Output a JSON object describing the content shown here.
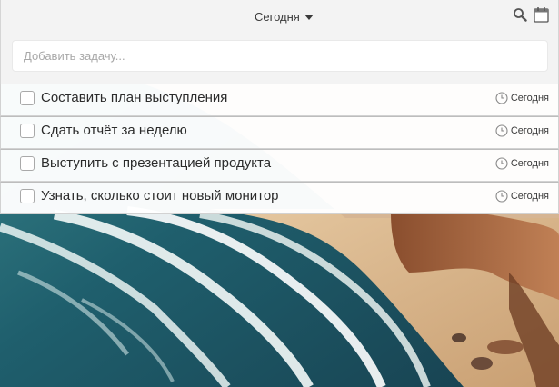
{
  "header": {
    "title": "Сегодня",
    "search_icon": "search-icon",
    "calendar_icon": "calendar-icon"
  },
  "add_task": {
    "placeholder": "Добавить задачу..."
  },
  "tasks": [
    {
      "text": "Составить план выступления",
      "due": "Сегодня",
      "done": false
    },
    {
      "text": "Сдать отчёт за неделю",
      "due": "Сегодня",
      "done": false
    },
    {
      "text": "Выступить с презентацией продукта",
      "due": "Сегодня",
      "done": false
    },
    {
      "text": "Узнать, сколько стоит новый монитор",
      "due": "Сегодня",
      "done": false
    }
  ],
  "colors": {
    "toolbar_bg": "#f3f3f3",
    "task_bg": "#ffffff",
    "text": "#2b2b2b",
    "sea": "#2f6f78",
    "sand": "#d9b48a",
    "rock": "#a86a45"
  }
}
